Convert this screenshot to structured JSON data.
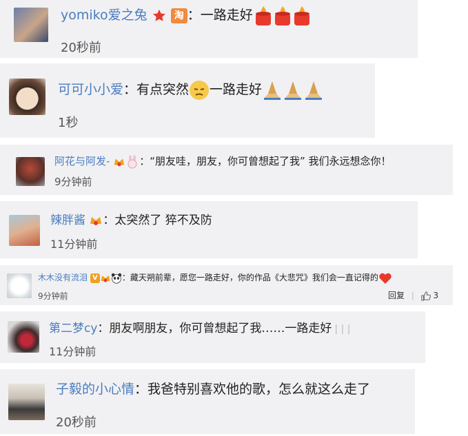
{
  "comments": [
    {
      "user": "yomiko爱之兔",
      "sep": "：",
      "text": "一路走好",
      "time": "20秒前"
    },
    {
      "user": "可可小小爱",
      "sep": "：",
      "text_before": "有点突然",
      "text_after": "一路走好",
      "time": "1秒"
    },
    {
      "user": "阿花与阿发-",
      "sep": "：",
      "text": "“朋友哇，朋友，你可曾想起了我” 我们永远想念你！",
      "time": "9分钟前"
    },
    {
      "user": "辣胖酱",
      "sep": "：",
      "text": "太突然了 猝不及防",
      "time": "11分钟前"
    },
    {
      "user": "木木没有流泪",
      "sep": "：",
      "text": "藏天朔前辈，愿您一路走好，你的作品《大悲咒》我们会一直记得的",
      "time": "9分钟前",
      "reply": "回复",
      "likes": "3"
    },
    {
      "user": "第二梦cy",
      "sep": "：",
      "text": "朋友啊朋友，你可曾想起了我……一路走好",
      "trail": "| | |",
      "time": "11分钟前"
    },
    {
      "user": "子毅的小心情",
      "sep": "：",
      "text": "我爸特别喜欢他的歌，怎么就这么走了",
      "time": "20秒前"
    }
  ],
  "badges": {
    "tao": "淘",
    "member": "V"
  },
  "colors": {
    "username": "#4a7cc0",
    "card_bg": "#f1f1f3",
    "candle": "#e8392d",
    "heart": "#e8392d"
  }
}
